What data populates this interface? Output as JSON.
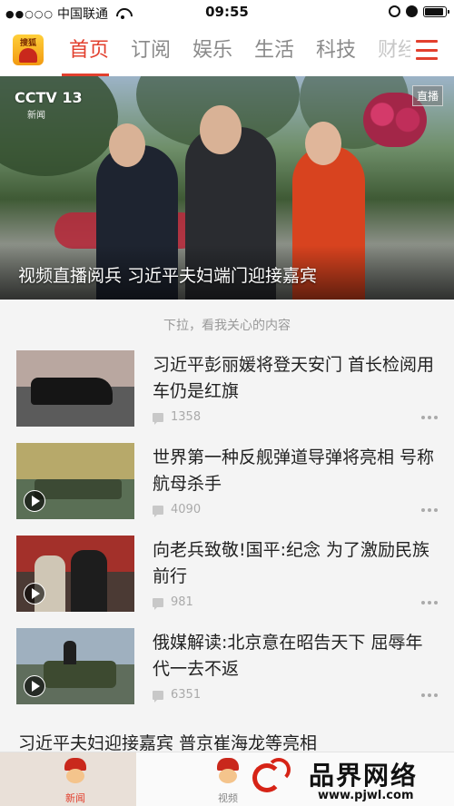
{
  "status_bar": {
    "signal": "●●○○○",
    "carrier": "中国联通",
    "time": "09:55"
  },
  "nav": {
    "logo_text": "搜狐",
    "tabs": [
      {
        "label": "首页",
        "active": true
      },
      {
        "label": "订阅",
        "active": false
      },
      {
        "label": "娱乐",
        "active": false
      },
      {
        "label": "生活",
        "active": false
      },
      {
        "label": "科技",
        "active": false
      },
      {
        "label": "财经",
        "active": false
      }
    ],
    "accent_color": "#e2402e"
  },
  "hero": {
    "channel_logo": "CCTV 13",
    "channel_sub": "新闻",
    "live_badge": "直播",
    "title": "视频直播阅兵  习近平夫妇端门迎接嘉宾"
  },
  "feed": {
    "pull_hint": "下拉，看我关心的内容",
    "items": [
      {
        "title": "习近平彭丽媛将登天安门 首长检阅用车仍是红旗",
        "comments": "1358",
        "video": false
      },
      {
        "title": "世界第一种反舰弹道导弹将亮相 号称航母杀手",
        "comments": "4090",
        "video": true
      },
      {
        "title": "向老兵致敬!国平:纪念 为了激励民族前行",
        "comments": "981",
        "video": true
      },
      {
        "title": "俄媒解读:北京意在昭告天下 屈辱年代一去不返",
        "comments": "6351",
        "video": true
      }
    ],
    "next_headline": "习近平夫妇迎接嘉宾 普京崔海龙等亮相"
  },
  "bottom_bar": {
    "tabs": [
      {
        "label": "新闻",
        "active": true
      },
      {
        "label": "视频",
        "active": false
      }
    ],
    "watermark_title": "品界网络",
    "watermark_url": "www.pjwl.com"
  }
}
